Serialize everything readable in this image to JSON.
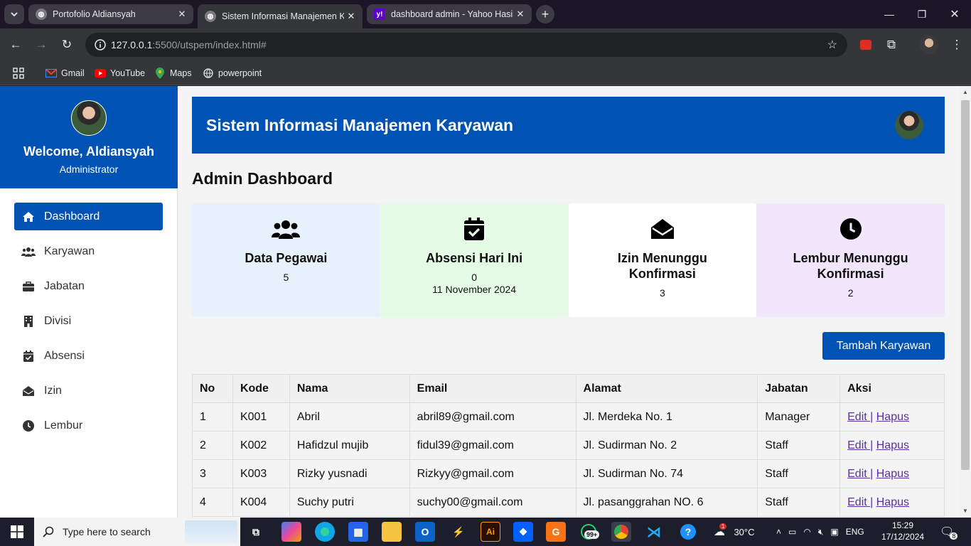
{
  "browser": {
    "tabs": [
      {
        "title": "Portofolio Aldiansyah",
        "active": false
      },
      {
        "title": "Sistem Informasi Manajemen K",
        "active": true
      },
      {
        "title": "dashboard admin - Yahoo Hasil",
        "active": false
      }
    ],
    "url_host": "127.0.0.1",
    "url_rest": ":5500/utspem/index.html#",
    "bookmarks": [
      "Gmail",
      "YouTube",
      "Maps",
      "powerpoint"
    ]
  },
  "sidebar": {
    "welcome": "Welcome, Aldiansyah",
    "role": "Administrator",
    "items": [
      {
        "label": "Dashboard",
        "icon": "home-icon",
        "active": true
      },
      {
        "label": "Karyawan",
        "icon": "users-icon",
        "active": false
      },
      {
        "label": "Jabatan",
        "icon": "briefcase-icon",
        "active": false
      },
      {
        "label": "Divisi",
        "icon": "building-icon",
        "active": false
      },
      {
        "label": "Absensi",
        "icon": "calendar-check-icon",
        "active": false
      },
      {
        "label": "Izin",
        "icon": "envelope-open-icon",
        "active": false
      },
      {
        "label": "Lembur",
        "icon": "clock-icon",
        "active": false
      }
    ]
  },
  "header": {
    "title": "Sistem Informasi Manajemen Karyawan"
  },
  "page_title": "Admin Dashboard",
  "cards": [
    {
      "label": "Data Pegawai",
      "value": "5",
      "sub": "",
      "color": "#e6f1fc"
    },
    {
      "label": "Absensi Hari Ini",
      "value": "0",
      "sub": "11 November 2024",
      "color": "#e6fbe6"
    },
    {
      "label": "Izin Menunggu Konfirmasi",
      "value": "3",
      "sub": "",
      "color": "#ffffff"
    },
    {
      "label": "Lembur Menunggu Konfirmasi",
      "value": "2",
      "sub": "",
      "color": "#f1e6fb"
    }
  ],
  "add_button": "Tambah Karyawan",
  "table": {
    "headers": [
      "No",
      "Kode",
      "Nama",
      "Email",
      "Alamat",
      "Jabatan",
      "Aksi"
    ],
    "rows": [
      [
        "1",
        "K001",
        "Abril",
        "abril89@gmail.com",
        "Jl. Merdeka No. 1",
        "Manager"
      ],
      [
        "2",
        "K002",
        "Hafidzul mujib",
        "fidul39@gmail.com",
        "Jl. Sudirman No. 2",
        "Staff"
      ],
      [
        "3",
        "K003",
        "Rizky yusnadi",
        "Rizkyy@gmail.com",
        "Jl. Sudirman No. 74",
        "Staff"
      ],
      [
        "4",
        "K004",
        "Suchy putri",
        "suchy00@gmail.com",
        "Jl. pasanggrahan NO. 6",
        "Staff"
      ]
    ],
    "edit_label": "Edit ",
    "sep": "|",
    "delete_label": "Hapus"
  },
  "taskbar": {
    "search_placeholder": "Type here to search",
    "temperature": "30°C",
    "language": "ENG",
    "time": "15:29",
    "date": "17/12/2024",
    "notif_count": "8",
    "whatsapp_badge": "99+",
    "weather_badge": "1"
  },
  "colors": {
    "brand": "#0052b4",
    "link": "#5b2ea6"
  }
}
